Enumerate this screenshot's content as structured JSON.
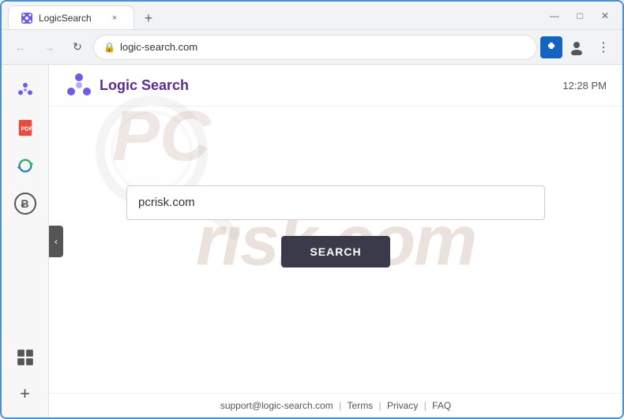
{
  "browser": {
    "tab": {
      "favicon": "❖",
      "title": "LogicSearch",
      "close_label": "×"
    },
    "new_tab_label": "+",
    "window_controls": {
      "minimize": "—",
      "maximize": "□",
      "close": "✕"
    },
    "nav": {
      "back_label": "←",
      "forward_label": "→",
      "reload_label": "↻",
      "url": "logic-search.com",
      "extensions_icon": "⚙",
      "account_icon": "👤",
      "menu_icon": "⋮"
    }
  },
  "sidebar": {
    "icons": [
      {
        "name": "logic-search-sidebar-icon",
        "symbol": "❖",
        "color": "#6c5ce7"
      },
      {
        "name": "pdf-icon",
        "symbol": "📄",
        "color": "#e74c3c"
      },
      {
        "name": "sync-icon",
        "symbol": "⟳",
        "color": "#27ae60"
      },
      {
        "name": "bitcoin-icon",
        "symbol": "Ƀ",
        "color": "#555"
      },
      {
        "name": "grid-icon",
        "symbol": "⊞",
        "color": "#555"
      }
    ],
    "add_label": "+"
  },
  "collapse_tab": {
    "label": "‹"
  },
  "page": {
    "logo": {
      "icon_color": "#6c5ce7",
      "text": "Logic Search"
    },
    "time": "12:28 PM",
    "search": {
      "placeholder": "pcrisk.com",
      "value": "pcrisk.com",
      "button_label": "SEARCH"
    },
    "watermark": "risk.com",
    "footer": {
      "support": "support@logic-search.com",
      "terms": "Terms",
      "privacy": "Privacy",
      "faq": "FAQ",
      "sep": "|"
    }
  }
}
